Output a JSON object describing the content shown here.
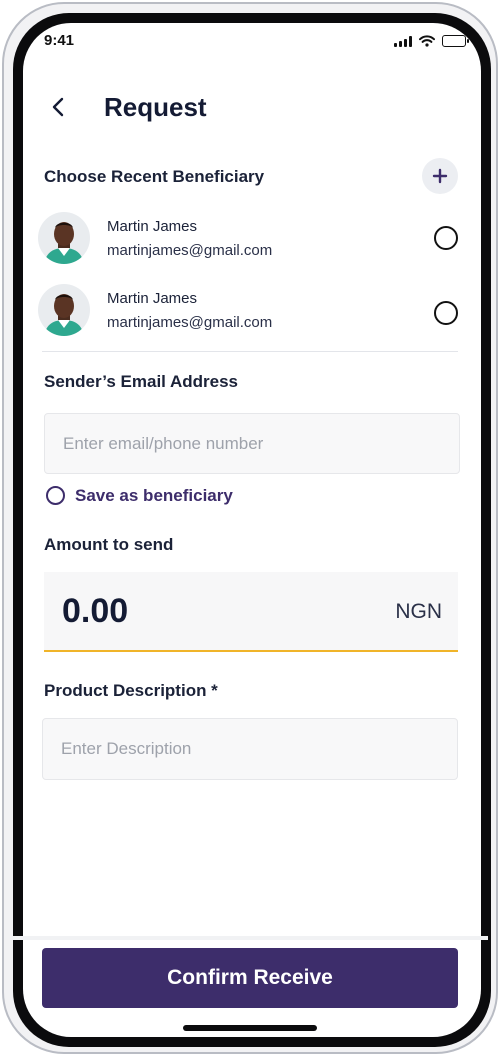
{
  "status_bar": {
    "time": "9:41"
  },
  "header": {
    "title": "Request"
  },
  "beneficiaries": {
    "section_label": "Choose Recent Beneficiary",
    "items": [
      {
        "name": "Martin James",
        "email": "martinjames@gmail.com",
        "avatar_icon": "person-avatar"
      },
      {
        "name": "Martin James",
        "email": "martinjames@gmail.com",
        "avatar_icon": "person-avatar"
      }
    ]
  },
  "sender": {
    "label": "Sender’s Email Address",
    "placeholder": "Enter email/phone number",
    "save_label": "Save as beneficiary"
  },
  "amount": {
    "label": "Amount to send",
    "value": "0.00",
    "currency": "NGN"
  },
  "description": {
    "label": "Product Description *",
    "placeholder": "Enter Description"
  },
  "actions": {
    "confirm_label": "Confirm Receive"
  },
  "colors": {
    "primary": "#3d2d6b",
    "accent": "#f0b429",
    "text": "#141b34"
  }
}
